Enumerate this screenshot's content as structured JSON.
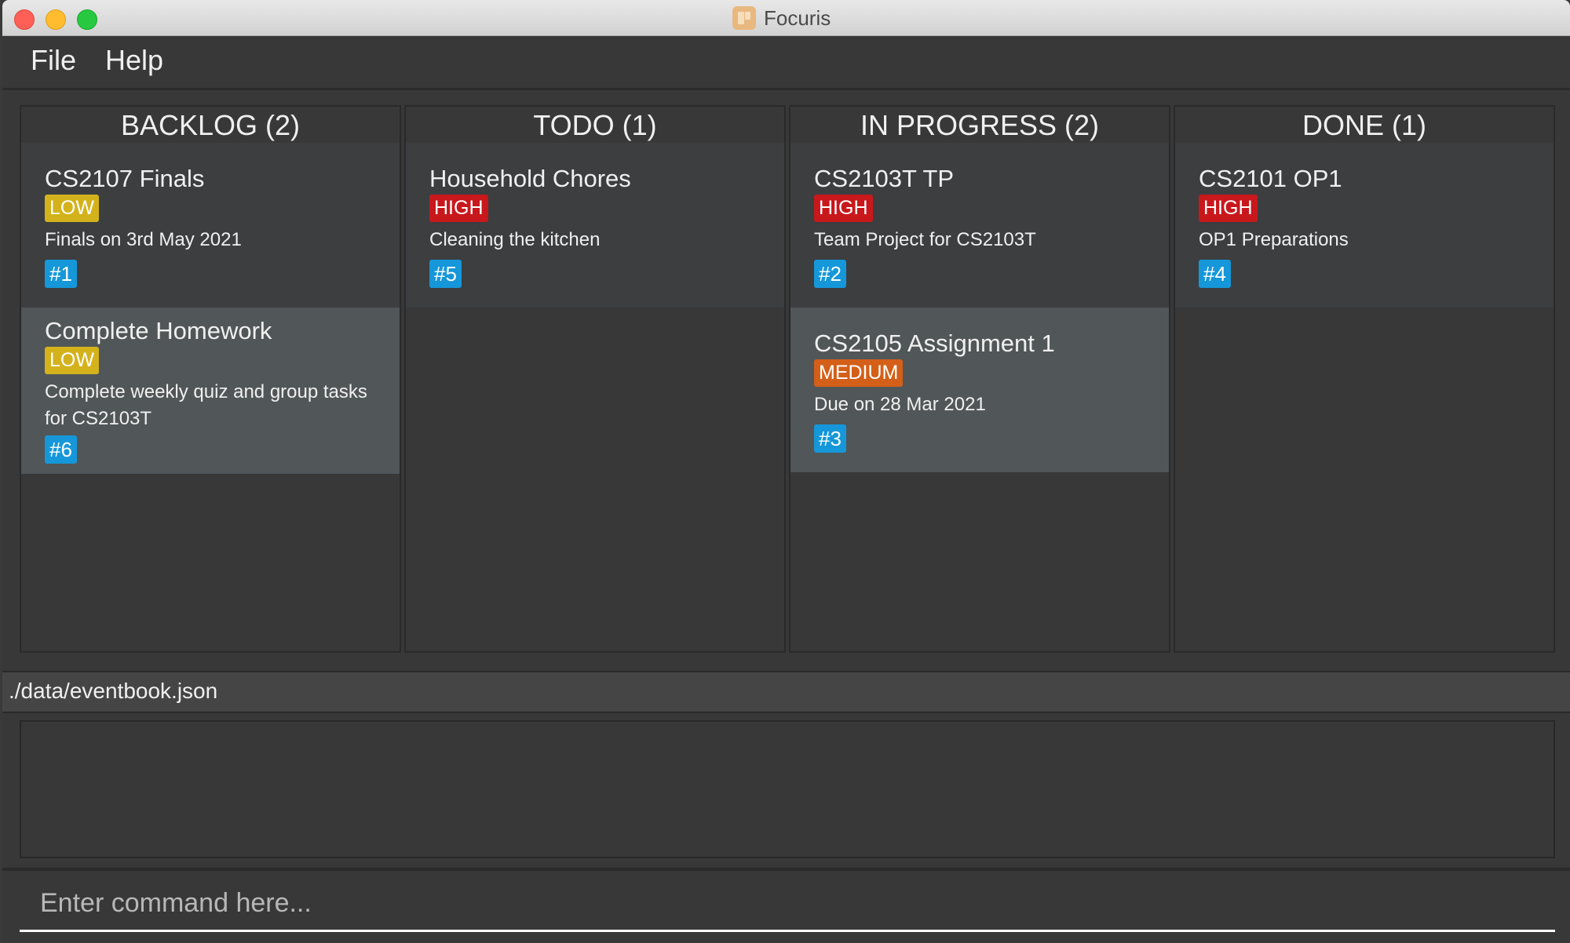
{
  "window": {
    "title": "Focuris",
    "icon": "kanban-board-icon"
  },
  "menu": {
    "items": [
      {
        "label": "File"
      },
      {
        "label": "Help"
      }
    ]
  },
  "colors": {
    "low": "#d4b21c",
    "medium": "#d35f18",
    "high": "#c8181c",
    "id_badge": "#1597d9",
    "card_even": "#3c3e40",
    "card_odd": "#515658",
    "background": "#383838"
  },
  "columns": [
    {
      "title": "BACKLOG (2)",
      "cards": [
        {
          "title": "CS2107 Finals",
          "priority": "LOW",
          "description": "Finals on 3rd May 2021",
          "id": "#1"
        },
        {
          "title": "Complete Homework",
          "priority": "LOW",
          "description": "Complete weekly quiz and group tasks for CS2103T",
          "id": "#6"
        }
      ]
    },
    {
      "title": "TODO (1)",
      "cards": [
        {
          "title": "Household Chores",
          "priority": "HIGH",
          "description": "Cleaning the kitchen",
          "id": "#5"
        }
      ]
    },
    {
      "title": "IN PROGRESS (2)",
      "cards": [
        {
          "title": "CS2103T TP",
          "priority": "HIGH",
          "description": "Team Project for CS2103T",
          "id": "#2"
        },
        {
          "title": "CS2105 Assignment 1",
          "priority": "MEDIUM",
          "description": "Due on 28 Mar 2021",
          "id": "#3"
        }
      ]
    },
    {
      "title": "DONE (1)",
      "cards": [
        {
          "title": "CS2101 OP1",
          "priority": "HIGH",
          "description": "OP1 Preparations",
          "id": "#4"
        }
      ]
    }
  ],
  "status_bar": {
    "file_path": "./data/eventbook.json"
  },
  "result_display": {
    "text": ""
  },
  "command_box": {
    "value": "",
    "placeholder": "Enter command here..."
  }
}
